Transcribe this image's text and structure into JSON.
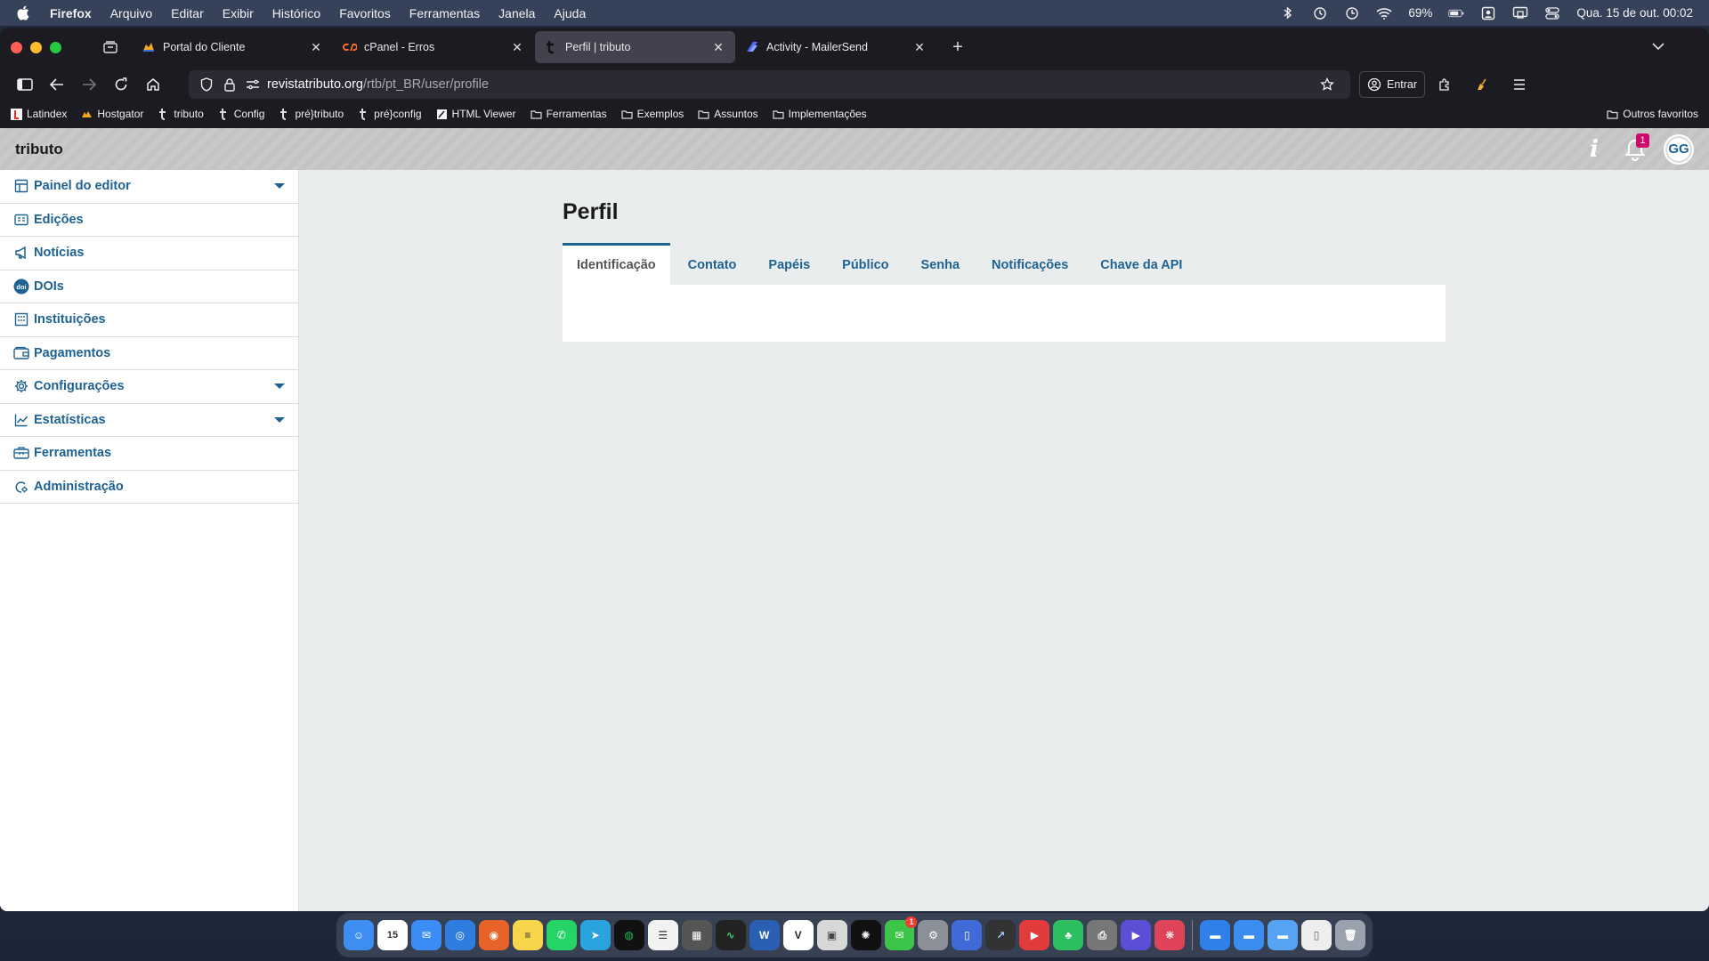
{
  "menubar": {
    "items": [
      "Firefox",
      "Arquivo",
      "Editar",
      "Exibir",
      "Histórico",
      "Favoritos",
      "Ferramentas",
      "Janela",
      "Ajuda"
    ],
    "battery": "69%",
    "clock": "Qua. 15 de out.  00:02"
  },
  "browser": {
    "tabs": [
      {
        "label": "Portal do Cliente",
        "active": false
      },
      {
        "label": "cPanel - Erros",
        "active": false
      },
      {
        "label": "Perfil | tributo",
        "active": true
      },
      {
        "label": "Activity - MailerSend",
        "active": false
      }
    ],
    "url_domain": "revistatributo.org",
    "url_path": "/rtb/pt_BR/user/profile",
    "signin_label": "Entrar",
    "bookmarks": [
      "Latindex",
      "Hostgator",
      "tributo",
      "Config",
      "pré}tributo",
      "pré}config",
      "HTML Viewer",
      "Ferramentas",
      "Exemplos",
      "Assuntos",
      "Implementações"
    ],
    "bookmarks_other": "Outros favoritos"
  },
  "app": {
    "context": "tributo",
    "notifications_count": "1",
    "avatar_initials": "GG",
    "sidebar": [
      {
        "label": "Painel do editor",
        "icon": "dashboard-icon",
        "caret": true
      },
      {
        "label": "Edições",
        "icon": "issues-icon",
        "caret": false
      },
      {
        "label": "Notícias",
        "icon": "megaphone-icon",
        "caret": false
      },
      {
        "label": "DOIs",
        "icon": "doi-icon",
        "caret": false
      },
      {
        "label": "Instituições",
        "icon": "institution-icon",
        "caret": false
      },
      {
        "label": "Pagamentos",
        "icon": "wallet-icon",
        "caret": false
      },
      {
        "label": "Configurações",
        "icon": "gear-icon",
        "caret": true
      },
      {
        "label": "Estatísticas",
        "icon": "chart-icon",
        "caret": true
      },
      {
        "label": "Ferramentas",
        "icon": "toolbox-icon",
        "caret": false
      },
      {
        "label": "Administração",
        "icon": "admin-icon",
        "caret": false
      }
    ],
    "page_title": "Perfil",
    "tabs": [
      "Identificação",
      "Contato",
      "Papéis",
      "Público",
      "Senha",
      "Notificações",
      "Chave da API"
    ],
    "active_tab": "Identificação"
  },
  "colors": {
    "brand": "#1e6292",
    "notification_badge": "#d00a6c"
  }
}
